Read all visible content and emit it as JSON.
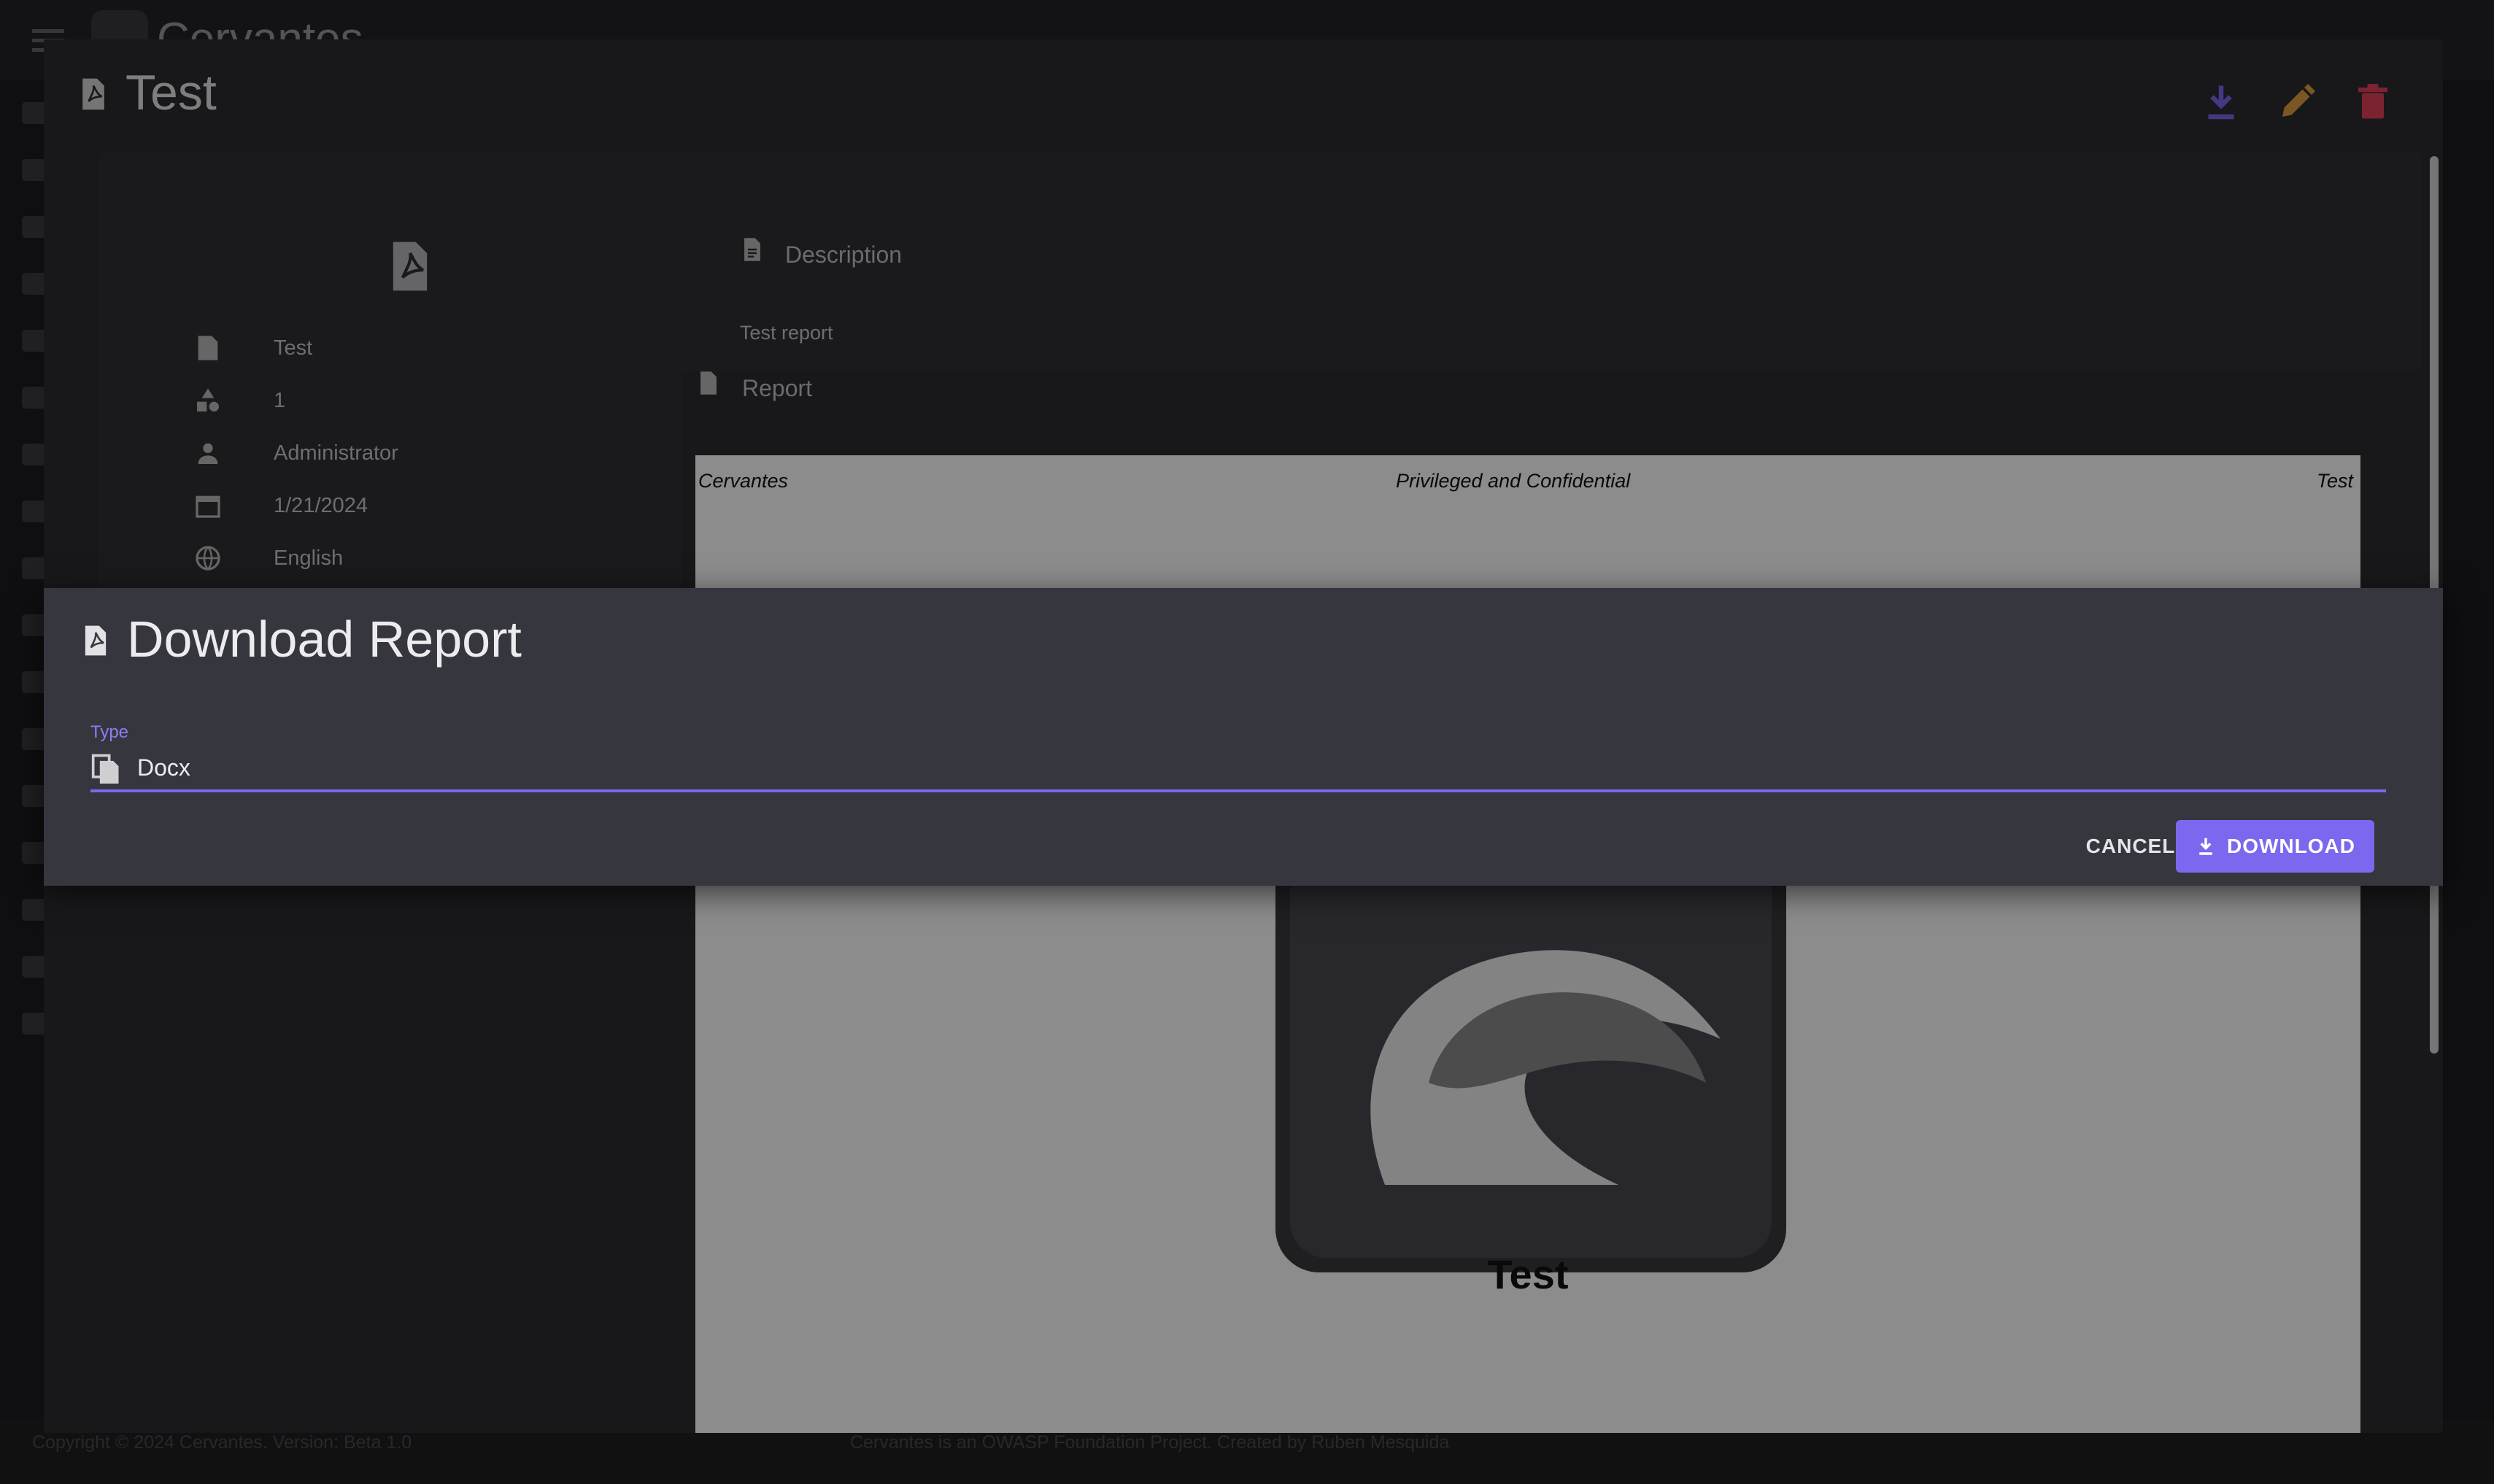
{
  "app": {
    "title": "Cervantes",
    "user": "Administrator"
  },
  "footer": {
    "copyright": "Copyright © 2024 Cervantes. Version: Beta 1.0",
    "owasp": "Cervantes is an OWASP Foundation Project. Created by Ruben Mesquida"
  },
  "report_dialog": {
    "title": "Test",
    "actions": {
      "download_icon": "download-icon",
      "edit_icon": "pencil-icon",
      "delete_icon": "trash-icon"
    },
    "details": [
      {
        "icon": "pdf-icon",
        "text": "Test"
      },
      {
        "icon": "shapes-icon",
        "text": "1"
      },
      {
        "icon": "person-icon",
        "text": "Administrator"
      },
      {
        "icon": "calendar-icon",
        "text": "1/21/2024"
      },
      {
        "icon": "globe-icon",
        "text": "English"
      }
    ],
    "description": {
      "label": "Description",
      "text": "Test report"
    },
    "report": {
      "label": "Report",
      "header_left": "Cervantes",
      "header_center": "Privileged and Confidential",
      "header_right": "Test",
      "doc_title": "Test"
    }
  },
  "download_dialog": {
    "title": "Download Report",
    "type_label": "Type",
    "type_value": "Docx",
    "cancel_label": "CANCEL",
    "download_label": "DOWNLOAD"
  },
  "colors": {
    "accent": "#7b68ee",
    "edit": "#e0a040",
    "delete": "#e0405a"
  }
}
